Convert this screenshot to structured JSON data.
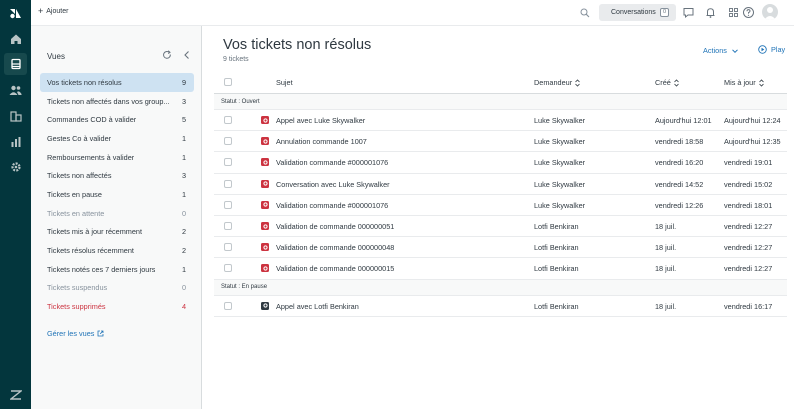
{
  "topbar": {
    "add_label": "Ajouter",
    "conversations_label": "Conversations",
    "conversations_count": "0"
  },
  "views": {
    "title": "Vues",
    "items": [
      {
        "label": "Vos tickets non résolus",
        "count": "9",
        "state": "active"
      },
      {
        "label": "Tickets non affectés dans vos group...",
        "count": "3",
        "state": ""
      },
      {
        "label": "Commandes COD à valider",
        "count": "5",
        "state": ""
      },
      {
        "label": "Gestes Co à valider",
        "count": "1",
        "state": ""
      },
      {
        "label": "Remboursements à valider",
        "count": "1",
        "state": ""
      },
      {
        "label": "Tickets non affectés",
        "count": "3",
        "state": ""
      },
      {
        "label": "Tickets en pause",
        "count": "1",
        "state": ""
      },
      {
        "label": "Tickets en attente",
        "count": "0",
        "state": "muted"
      },
      {
        "label": "Tickets mis à jour récemment",
        "count": "2",
        "state": ""
      },
      {
        "label": "Tickets résolus récemment",
        "count": "2",
        "state": ""
      },
      {
        "label": "Tickets notés ces 7 derniers jours",
        "count": "1",
        "state": ""
      },
      {
        "label": "Tickets suspendus",
        "count": "0",
        "state": "muted"
      },
      {
        "label": "Tickets supprimés",
        "count": "4",
        "state": "danger"
      }
    ],
    "manage_label": "Gérer les vues"
  },
  "main": {
    "title": "Vos tickets non résolus",
    "count_label": "9 tickets",
    "actions_label": "Actions",
    "play_label": "Play",
    "columns": {
      "subject": "Sujet",
      "requester": "Demandeur",
      "created": "Créé",
      "updated": "Mis à jour"
    },
    "groups": [
      {
        "label": "Statut : Ouvert",
        "rows": [
          {
            "subject": "Appel avec Luke Skywalker",
            "requester": "Luke Skywalker",
            "created": "Aujourd'hui 12:01",
            "updated": "Aujourd'hui 12:24",
            "status": "ouvert"
          },
          {
            "subject": "Annulation commande 1007",
            "requester": "Luke Skywalker",
            "created": "vendredi 18:58",
            "updated": "Aujourd'hui 12:35",
            "status": "ouvert"
          },
          {
            "subject": "Validation commande #000001076",
            "requester": "Luke Skywalker",
            "created": "vendredi 16:20",
            "updated": "vendredi 19:01",
            "status": "ouvert"
          },
          {
            "subject": "Conversation avec Luke Skywalker",
            "requester": "Luke Skywalker",
            "created": "vendredi 14:52",
            "updated": "vendredi 15:02",
            "status": "ouvert"
          },
          {
            "subject": "Validation commande #000001076",
            "requester": "Luke Skywalker",
            "created": "vendredi 12:26",
            "updated": "vendredi 18:01",
            "status": "ouvert"
          },
          {
            "subject": "Validation de commande 000000051",
            "requester": "Lotfi Benkiran",
            "created": "18 juil.",
            "updated": "vendredi 12:27",
            "status": "ouvert"
          },
          {
            "subject": "Validation de commande 000000048",
            "requester": "Lotfi Benkiran",
            "created": "18 juil.",
            "updated": "vendredi 12:27",
            "status": "ouvert"
          },
          {
            "subject": "Validation de commande 000000015",
            "requester": "Lotfi Benkiran",
            "created": "18 juil.",
            "updated": "vendredi 12:27",
            "status": "ouvert"
          }
        ]
      },
      {
        "label": "Statut : En pause",
        "rows": [
          {
            "subject": "Appel avec Lotfi Benkiran",
            "requester": "Lotfi Benkiran",
            "created": "18 juil.",
            "updated": "vendredi 16:17",
            "status": "pause"
          }
        ]
      }
    ]
  },
  "colors": {
    "rail": "#03363d",
    "accent": "#1f73b7",
    "open_status": "#cc3340",
    "pause_status": "#2f3941",
    "selected_view": "#cee2f2"
  }
}
